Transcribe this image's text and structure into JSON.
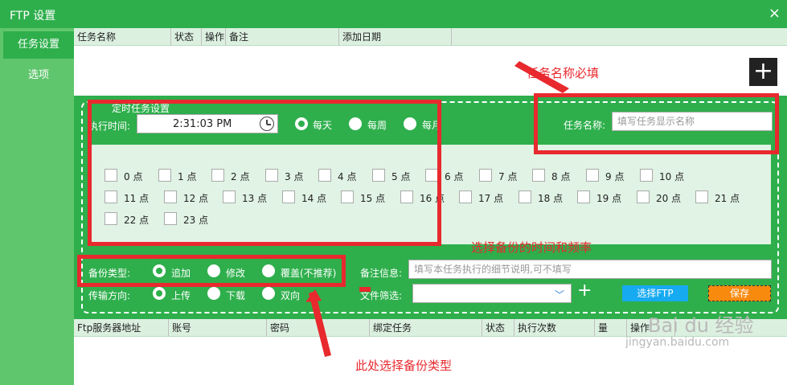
{
  "window": {
    "title": "FTP 设置",
    "close_icon": "×"
  },
  "sidebar": {
    "items": [
      {
        "label": "任务设置"
      },
      {
        "label": "选项"
      }
    ]
  },
  "task_table": {
    "headers": [
      "任务名称",
      "状态",
      "操作",
      "备注",
      "添加日期"
    ]
  },
  "add_button": {
    "label": "+"
  },
  "form": {
    "legend": "定时任务设置",
    "exec_time_label": "执行时间:",
    "exec_time_value": "2:31:03 PM",
    "frequency": {
      "options": [
        "每天",
        "每周",
        "每月"
      ],
      "selected": "每天"
    },
    "task_name_label": "任务名称:",
    "task_name_placeholder": "填写任务显示名称",
    "hours": [
      "0 点",
      "1 点",
      "2 点",
      "3 点",
      "4 点",
      "5 点",
      "6 点",
      "7 点",
      "8 点",
      "9 点",
      "10 点",
      "11 点",
      "12 点",
      "13 点",
      "14 点",
      "15 点",
      "16 点",
      "17 点",
      "18 点",
      "19 点",
      "20 点",
      "21 点",
      "22 点",
      "23 点"
    ],
    "backup_type_label": "备份类型:",
    "backup_types": [
      "追加",
      "修改",
      "覆盖(不推荐)"
    ],
    "backup_type_selected": "追加",
    "note_label": "备注信息:",
    "note_placeholder": "填写本任务执行的细节说明,可不填写",
    "direction_label": "传输方向:",
    "directions": [
      "上传",
      "下载",
      "双向"
    ],
    "direction_selected": "上传",
    "file_filter_label": "文件筛选:",
    "plus_label": "+",
    "select_ftp_label": "选择FTP",
    "save_label": "保存"
  },
  "server_table": {
    "headers": [
      "Ftp服务器地址",
      "账号",
      "密码",
      "绑定任务",
      "状态",
      "执行次数",
      "量",
      "操作"
    ]
  },
  "annotations": {
    "task_name_required": "任务名称必填",
    "choose_time": "选择备份的时间和频率",
    "choose_type": "此处选择备份类型"
  },
  "watermark": {
    "brand": "Bai du 经验",
    "url": "jingyan.baidu.com"
  },
  "colors": {
    "primary_green": "#2eaf4c",
    "sidebar_green": "#60c66d",
    "light_green": "#e0f3e4",
    "annotation_red": "#e8292e",
    "ftp_blue": "#16aaf0",
    "save_orange": "#f88a0e"
  }
}
